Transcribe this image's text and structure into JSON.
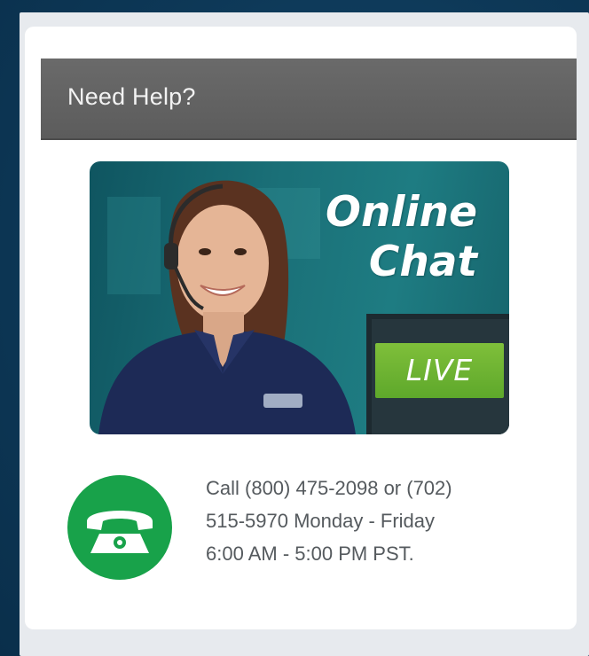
{
  "widget": {
    "title": "Need Help?",
    "chat_banner": {
      "title_line1": "Online",
      "title_line2": "Chat",
      "badge": "LIVE",
      "colors": {
        "background": "#1a6f77",
        "badge": "#6cb232",
        "text": "#ffffff"
      }
    },
    "phone": {
      "icon": "telephone-icon",
      "lines": [
        "Call (800) 475-2098 or (702)",
        "515-5970 Monday - Friday",
        "6:00 AM - 5:00 PM PST."
      ],
      "icon_color": "#18a24a"
    },
    "header_color": "#636363",
    "page_background": "#0e3a59"
  }
}
